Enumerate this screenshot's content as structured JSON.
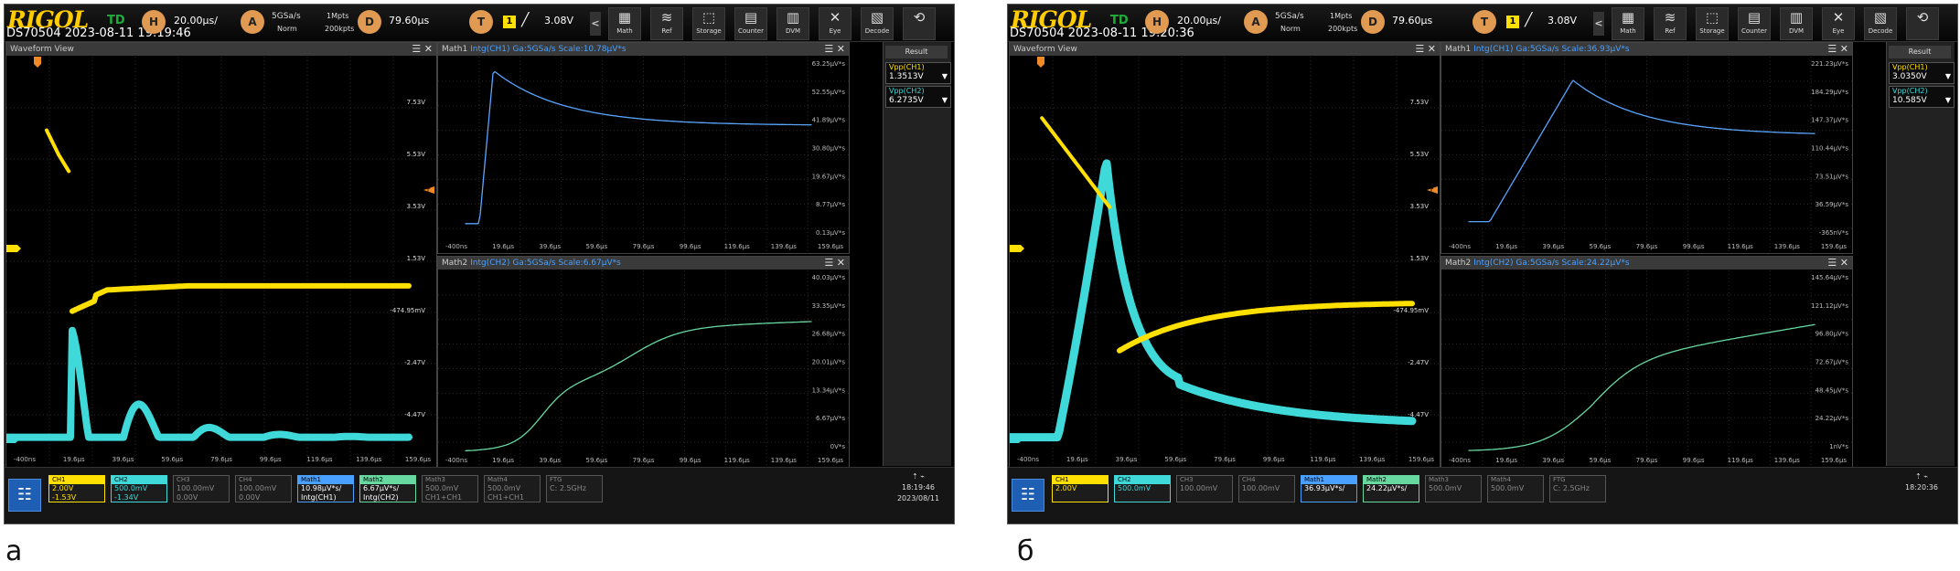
{
  "panels": [
    {
      "label": "а",
      "brand": "RIGOL",
      "model_time": "DS70504 2023-08-11 19:19:46",
      "trigger_mode": "TD",
      "horizontal": {
        "knob": "H",
        "value": "20.00µs/"
      },
      "acquisition": {
        "knob": "A",
        "rate": "5GSa/s",
        "mode": "Norm",
        "depth": "1Mpts",
        "points": "200kpts"
      },
      "delay": {
        "knob": "D",
        "value": "79.60µs"
      },
      "trigger": {
        "knob": "T",
        "source": "1",
        "level": "3.08V"
      },
      "toolbar": [
        {
          "icon": "math-icon",
          "glyph": "▦",
          "label": "Math"
        },
        {
          "icon": "ref-icon",
          "glyph": "≋",
          "label": "Ref"
        },
        {
          "icon": "storage-icon",
          "glyph": "⬚",
          "label": "Storage"
        },
        {
          "icon": "counter-icon",
          "glyph": "▤",
          "label": "Counter"
        },
        {
          "icon": "dvm-icon",
          "glyph": "▥",
          "label": "DVM"
        },
        {
          "icon": "eye-icon",
          "glyph": "✕",
          "label": "Eye"
        },
        {
          "icon": "decode-icon",
          "glyph": "▧",
          "label": "Decode"
        },
        {
          "icon": "refresh-icon",
          "glyph": "⟲",
          "label": ""
        }
      ],
      "waveform": {
        "title": "Waveform View",
        "y_ticks": [
          "7.53V",
          "5.53V",
          "3.53V",
          "1.53V",
          "-474.95mV",
          "-2.47V",
          "-4.47V"
        ],
        "x_ticks": [
          "-400ns",
          "19.6µs",
          "39.6µs",
          "59.6µs",
          "79.6µs",
          "99.6µs",
          "119.6µs",
          "139.6µs",
          "159.6µs"
        ],
        "trigger_level_marker": "T"
      },
      "math1": {
        "title": "Math1",
        "func": "Intg(CH1)",
        "rate": "Ga:5GSa/s",
        "scale": "Scale:10.78µV*s",
        "y_ticks": [
          "63.25µV*s",
          "52.55µV*s",
          "41.89µV*s",
          "30.80µV*s",
          "19.67µV*s",
          "8.77µV*s",
          "0.13µV*s"
        ],
        "x_ticks": [
          "-400ns",
          "19.6µs",
          "39.6µs",
          "59.6µs",
          "79.6µs",
          "99.6µs",
          "119.6µs",
          "139.6µs",
          "159.6µs"
        ]
      },
      "math2": {
        "title": "Math2",
        "func": "Intg(CH2)",
        "rate": "Ga:5GSa/s",
        "scale": "Scale:6.67µV*s",
        "y_ticks": [
          "40.03µV*s",
          "33.35µV*s",
          "26.68µV*s",
          "20.01µV*s",
          "13.34µV*s",
          "6.67µV*s",
          "0V*s"
        ],
        "x_ticks": [
          "-400ns",
          "19.6µs",
          "39.6µs",
          "59.6µs",
          "79.6µs",
          "99.6µs",
          "119.6µs",
          "139.6µs",
          "159.6µs"
        ]
      },
      "result": {
        "title": "Result",
        "items": [
          {
            "label": "Vpp(CH1)",
            "value": "1.3513V"
          },
          {
            "label": "Vpp(CH2)",
            "value": "6.2735V"
          }
        ]
      },
      "bottom": {
        "ch1": {
          "title": "CH1",
          "scale": "2.00V",
          "offset": "-1.53V"
        },
        "ch2": {
          "title": "CH2",
          "scale": "500.0mV",
          "offset": "-1.34V"
        },
        "ch3": {
          "title": "CH3",
          "scale": "100.00mV",
          "offset": "0.00V"
        },
        "ch4": {
          "title": "CH4",
          "scale": "100.00mV",
          "offset": "0.00V"
        },
        "m1": {
          "title": "Math1",
          "scale": "10.98µV*s/",
          "offset": "Intg(CH1)"
        },
        "m2": {
          "title": "Math2",
          "scale": "6.67µV*s/",
          "offset": "Intg(CH2)"
        },
        "m3": {
          "title": "Math3",
          "scale": "500.0mV",
          "offset": "CH1+CH1"
        },
        "m4": {
          "title": "Math4",
          "scale": "500.0mV",
          "offset": "CH1+CH1"
        },
        "ftg": {
          "title": "FTG",
          "scale": "",
          "offset": "C: 2.5GHz"
        }
      },
      "clock": {
        "time": "18:19:46",
        "date": "2023/08/11"
      }
    },
    {
      "label": "б",
      "brand": "RIGOL",
      "model_time": "DS70504 2023-08-11 19:20:36",
      "trigger_mode": "TD",
      "horizontal": {
        "knob": "H",
        "value": "20.00µs/"
      },
      "acquisition": {
        "knob": "A",
        "rate": "5GSa/s",
        "mode": "Norm",
        "depth": "1Mpts",
        "points": "200kpts"
      },
      "delay": {
        "knob": "D",
        "value": "79.60µs"
      },
      "trigger": {
        "knob": "T",
        "source": "1",
        "level": "3.08V"
      },
      "toolbar": [
        {
          "icon": "math-icon",
          "glyph": "▦",
          "label": "Math"
        },
        {
          "icon": "ref-icon",
          "glyph": "≋",
          "label": "Ref"
        },
        {
          "icon": "storage-icon",
          "glyph": "⬚",
          "label": "Storage"
        },
        {
          "icon": "counter-icon",
          "glyph": "▤",
          "label": "Counter"
        },
        {
          "icon": "dvm-icon",
          "glyph": "▥",
          "label": "DVM"
        },
        {
          "icon": "eye-icon",
          "glyph": "✕",
          "label": "Eye"
        },
        {
          "icon": "decode-icon",
          "glyph": "▧",
          "label": "Decode"
        },
        {
          "icon": "refresh-icon",
          "glyph": "⟲",
          "label": ""
        }
      ],
      "waveform": {
        "title": "Waveform View",
        "y_ticks": [
          "7.53V",
          "5.53V",
          "3.53V",
          "1.53V",
          "-474.95mV",
          "-2.47V",
          "-4.47V"
        ],
        "x_ticks": [
          "-400ns",
          "19.6µs",
          "39.6µs",
          "59.6µs",
          "79.6µs",
          "99.6µs",
          "119.6µs",
          "139.6µs",
          "159.6µs"
        ],
        "trigger_level_marker": "T"
      },
      "math1": {
        "title": "Math1",
        "func": "Intg(CH1)",
        "rate": "Ga:5GSa/s",
        "scale": "Scale:36.93µV*s",
        "y_ticks": [
          "221.23µV*s",
          "184.29µV*s",
          "147.37µV*s",
          "110.44µV*s",
          "73.51µV*s",
          "36.59µV*s",
          "-365nV*s"
        ],
        "x_ticks": [
          "-400ns",
          "19.6µs",
          "39.6µs",
          "59.6µs",
          "79.6µs",
          "99.6µs",
          "119.6µs",
          "139.6µs",
          "159.6µs"
        ]
      },
      "math2": {
        "title": "Math2",
        "func": "Intg(CH2)",
        "rate": "Ga:5GSa/s",
        "scale": "Scale:24.22µV*s",
        "y_ticks": [
          "145.64µV*s",
          "121.12µV*s",
          "96.80µV*s",
          "72.67µV*s",
          "48.45µV*s",
          "24.22µV*s",
          "1nV*s"
        ],
        "x_ticks": [
          "-400ns",
          "19.6µs",
          "39.6µs",
          "59.6µs",
          "79.6µs",
          "99.6µs",
          "119.6µs",
          "139.6µs",
          "159.6µs"
        ]
      },
      "result": {
        "title": "Result",
        "items": [
          {
            "label": "Vpp(CH1)",
            "value": "3.0350V"
          },
          {
            "label": "Vpp(CH2)",
            "value": "10.585V"
          }
        ]
      },
      "bottom": {
        "ch1": {
          "title": "CH1",
          "scale": "2.00V",
          "offset": ""
        },
        "ch2": {
          "title": "CH2",
          "scale": "500.0mV",
          "offset": ""
        },
        "ch3": {
          "title": "CH3",
          "scale": "100.00mV",
          "offset": ""
        },
        "ch4": {
          "title": "CH4",
          "scale": "100.00mV",
          "offset": ""
        },
        "m1": {
          "title": "Math1",
          "scale": "36.93µV*s/",
          "offset": ""
        },
        "m2": {
          "title": "Math2",
          "scale": "24.22µV*s/",
          "offset": ""
        },
        "m3": {
          "title": "Math3",
          "scale": "500.0mV",
          "offset": ""
        },
        "m4": {
          "title": "Math4",
          "scale": "500.0mV",
          "offset": ""
        },
        "ftg": {
          "title": "FTG",
          "scale": "",
          "offset": "C: 2.5GHz"
        }
      },
      "clock": {
        "time": "18:20:36",
        "date": ""
      }
    }
  ],
  "colors": {
    "ch1": "#ffe000",
    "ch2": "#3fd9d9",
    "math1": "#5aa5ff",
    "math2": "#67d9a0",
    "trigger": "#f08a24",
    "grid": "#2b2b2b"
  }
}
